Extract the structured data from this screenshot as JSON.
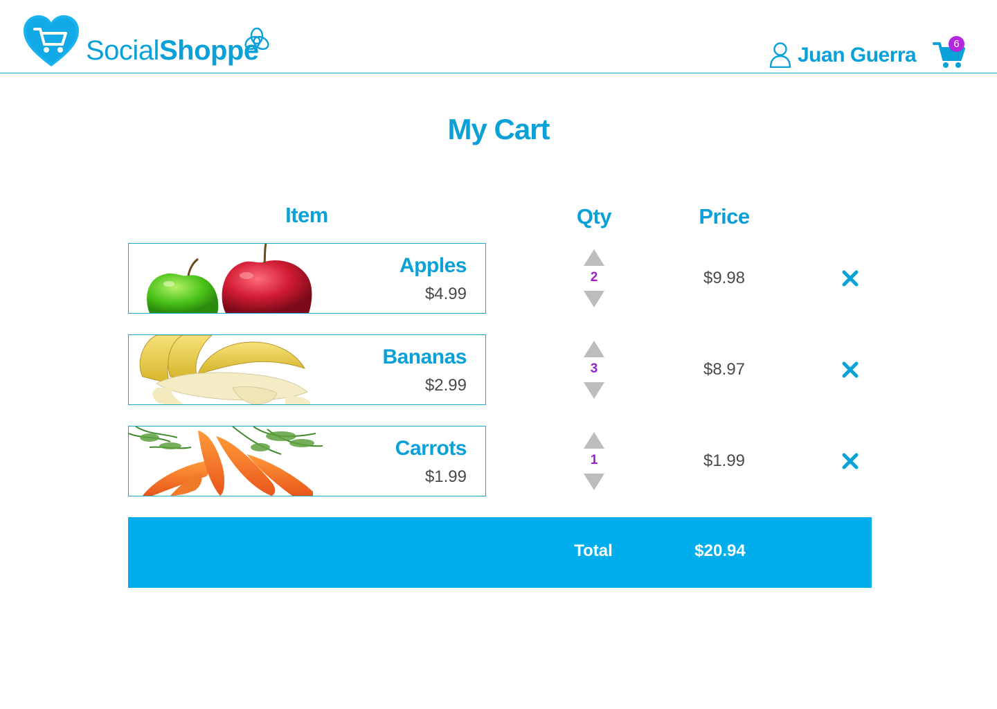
{
  "header": {
    "brand_part1": "Social",
    "brand_part2": "Shoppe",
    "user_name": "Juan Guerra",
    "cart_count": "6"
  },
  "page_title": "My Cart",
  "columns": {
    "item": "Item",
    "qty": "Qty",
    "price": "Price"
  },
  "items": [
    {
      "name": "Apples",
      "unit_price": "$4.99",
      "qty": "2",
      "line_total": "$9.98",
      "image": "apples"
    },
    {
      "name": "Bananas",
      "unit_price": "$2.99",
      "qty": "3",
      "line_total": "$8.97",
      "image": "bananas"
    },
    {
      "name": "Carrots",
      "unit_price": "$1.99",
      "qty": "1",
      "line_total": "$1.99",
      "image": "carrots"
    }
  ],
  "total": {
    "label": "Total",
    "value": "$20.94"
  },
  "colors": {
    "brand": "#0aa0d8",
    "total_bar": "#02adec",
    "badge": "#b526e0",
    "qty_text": "#9b1fc9",
    "arrow_gray": "#bdbdbd"
  },
  "icons": {
    "logo": "heart-cart-icon",
    "brand_mark": "knot-icon",
    "user": "user-icon",
    "cart": "cart-icon",
    "qty_up": "triangle-up-icon",
    "qty_down": "triangle-down-icon",
    "remove": "close-icon"
  }
}
